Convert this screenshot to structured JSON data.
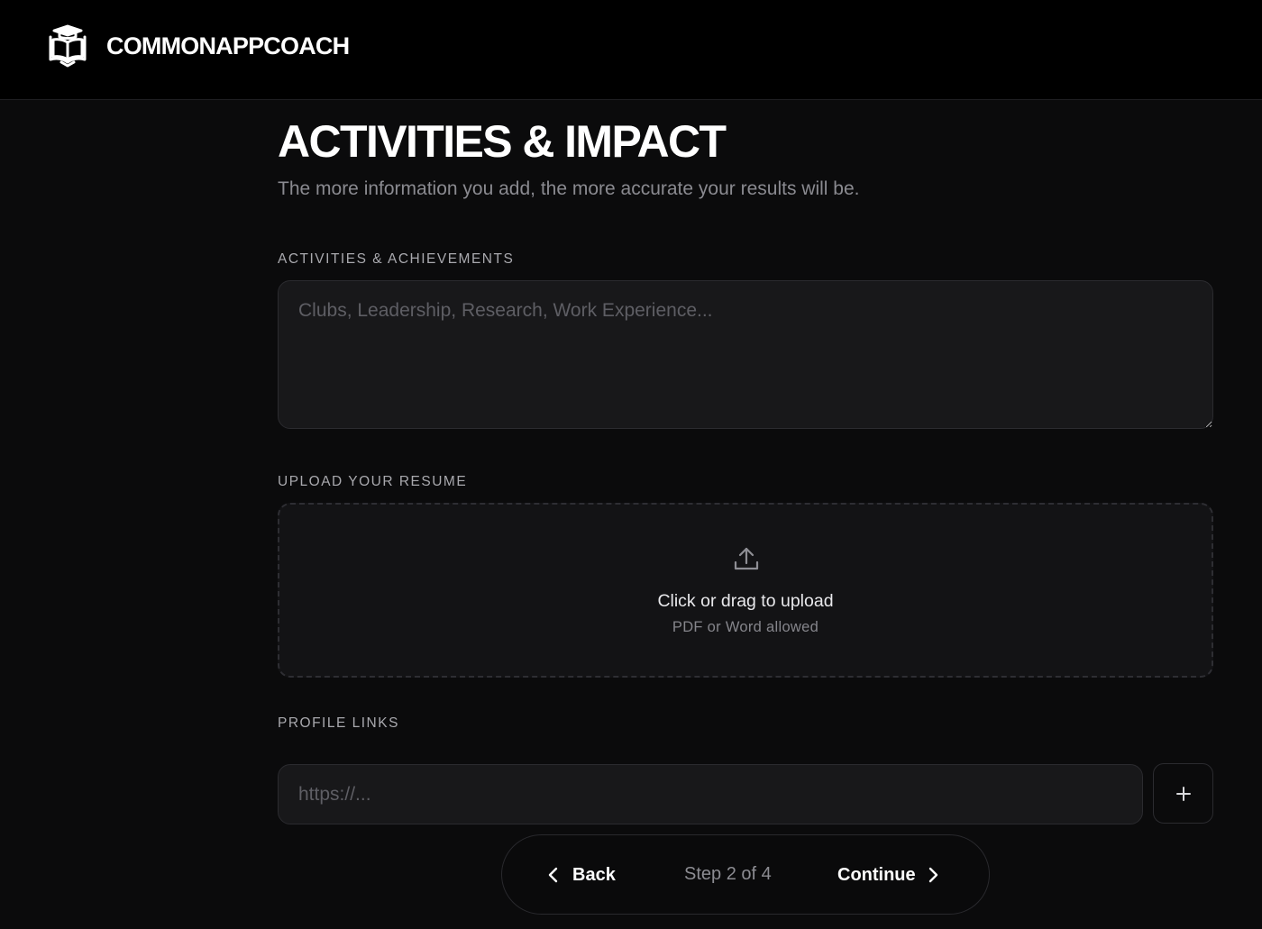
{
  "header": {
    "brand_name": "COMMONAPPCOACH",
    "logo_icon": "graduation-cap-book-icon"
  },
  "page": {
    "title": "ACTIVITIES & IMPACT",
    "subtitle": "The more information you add, the more accurate your results will be."
  },
  "activities": {
    "label": "ACTIVITIES & ACHIEVEMENTS",
    "value": "",
    "placeholder": "Clubs, Leadership, Research, Work Experience..."
  },
  "resume": {
    "label": "UPLOAD YOUR RESUME",
    "icon": "upload-icon",
    "title": "Click or drag to upload",
    "hint": "PDF or Word allowed"
  },
  "links": {
    "label": "PROFILE LINKS",
    "value": "",
    "placeholder": "https://...",
    "add_icon": "plus-icon"
  },
  "nav": {
    "back_label": "Back",
    "step_text": "Step 2 of 4",
    "continue_label": "Continue"
  },
  "colors": {
    "background": "#0b0b0c",
    "header_background": "#000000",
    "field_background": "#18181a",
    "border": "#2b2b2f",
    "muted_text": "#8a8a90"
  }
}
